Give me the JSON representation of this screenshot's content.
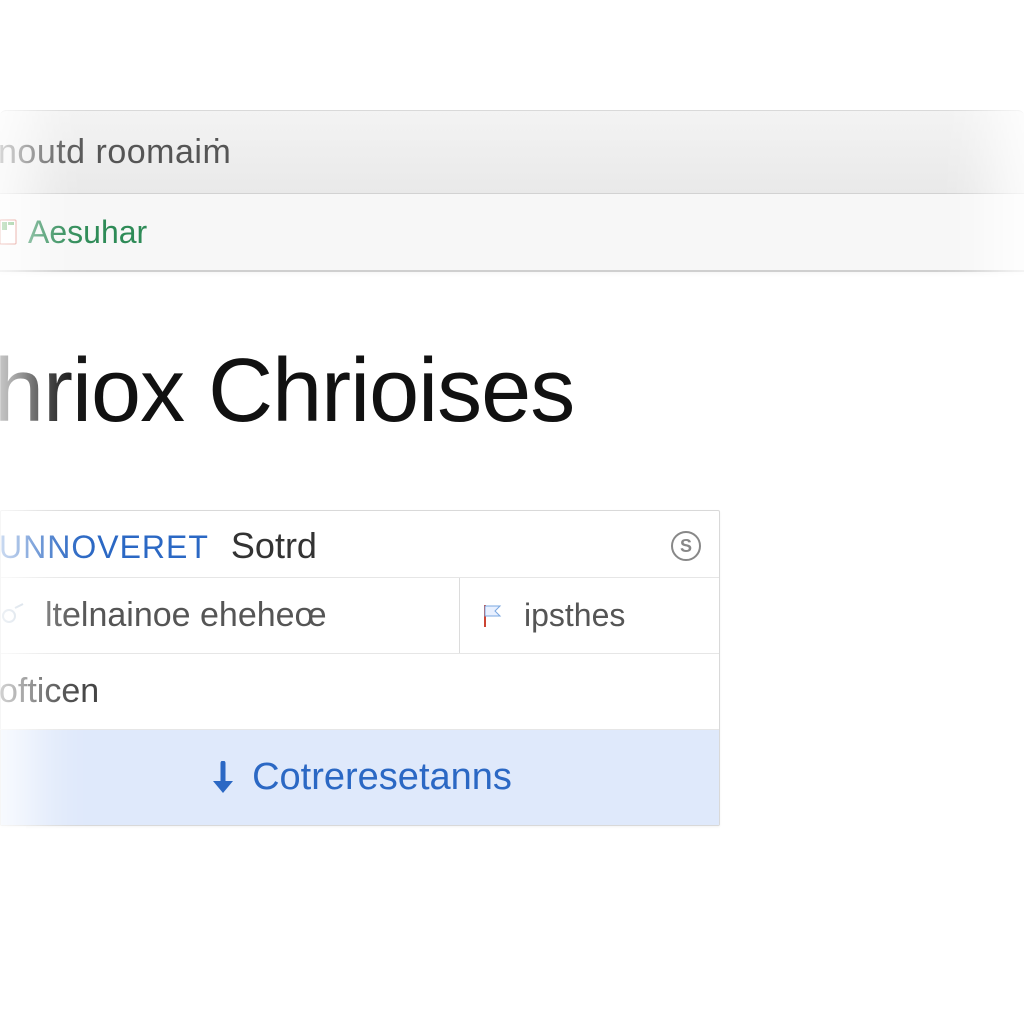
{
  "titlebar": {
    "text": "noutd roomaiṁ"
  },
  "toolbar": {
    "item_label": "Aesuhar"
  },
  "page": {
    "heading": "hriox Chrioises"
  },
  "panel": {
    "header_link": "unnoveret",
    "header_label": "Sotrd",
    "info_glyph": "S",
    "row1_left": "ltelnainoe eheheœ",
    "row1_right": "ipsthes",
    "row2": "ofticen",
    "footer": "Cotreresetanns"
  }
}
